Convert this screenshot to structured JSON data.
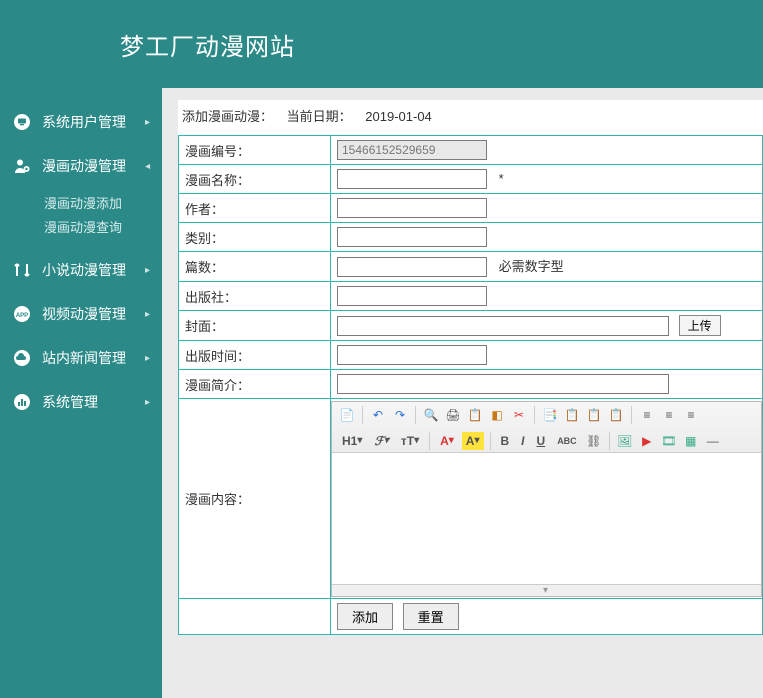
{
  "site_title": "梦工厂动漫网站",
  "sidebar": {
    "items": [
      {
        "label": "系统用户管理",
        "icon": "monitor-icon",
        "expanded": false
      },
      {
        "label": "漫画动漫管理",
        "icon": "user-gear-icon",
        "expanded": true,
        "children": [
          {
            "label": "漫画动漫添加"
          },
          {
            "label": "漫画动漫查询"
          }
        ]
      },
      {
        "label": "小说动漫管理",
        "icon": "arrows-icon",
        "expanded": false
      },
      {
        "label": "视频动漫管理",
        "icon": "app-icon",
        "expanded": false
      },
      {
        "label": "站内新闻管理",
        "icon": "cloud-icon",
        "expanded": false
      },
      {
        "label": "系统管理",
        "icon": "bars-icon",
        "expanded": false
      }
    ]
  },
  "crumb": {
    "title": "添加漫画动漫：",
    "date_label": "当前日期：",
    "date_value": "2019-01-04"
  },
  "form": {
    "fields": {
      "code": {
        "label": "漫画编号：",
        "value": "15466152529659"
      },
      "name": {
        "label": "漫画名称：",
        "value": "",
        "required_mark": "*"
      },
      "author": {
        "label": "作者：",
        "value": ""
      },
      "category": {
        "label": "类别：",
        "value": ""
      },
      "count": {
        "label": "篇数：",
        "value": "",
        "hint": "必需数字型"
      },
      "publisher": {
        "label": "出版社：",
        "value": ""
      },
      "cover": {
        "label": "封面：",
        "value": "",
        "upload_label": "上传"
      },
      "pubdate": {
        "label": "出版时间：",
        "value": ""
      },
      "intro": {
        "label": "漫画简介：",
        "value": ""
      },
      "content": {
        "label": "漫画内容：",
        "value": ""
      }
    },
    "buttons": {
      "submit": "添加",
      "reset": "重置"
    }
  },
  "editor_toolbar": {
    "r1": [
      "source",
      "undo",
      "redo",
      "copy",
      "print",
      "preview",
      "template",
      "cut",
      "copy2",
      "paste",
      "paste2",
      "paste3",
      "align-l",
      "align-c",
      "align-r"
    ],
    "r2": [
      "H1",
      "F",
      "tT",
      "A",
      "hl",
      "B",
      "I",
      "U",
      "abc",
      "link",
      "img",
      "flash",
      "media",
      "table",
      "hr"
    ]
  }
}
